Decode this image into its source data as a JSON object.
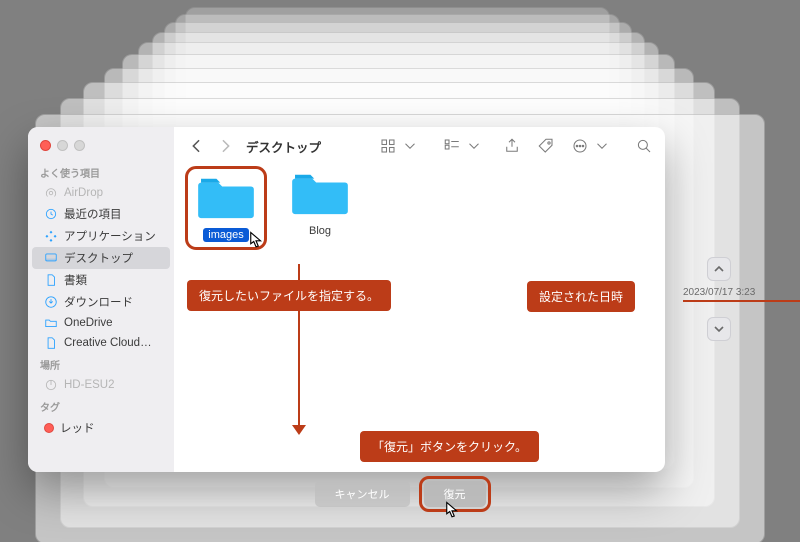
{
  "window": {
    "title": "デスクトップ"
  },
  "sidebar": {
    "sections": {
      "favorites": "よく使う項目",
      "locations": "場所",
      "tags": "タグ"
    },
    "items": [
      {
        "label": "AirDrop"
      },
      {
        "label": "最近の項目"
      },
      {
        "label": "アプリケーション"
      },
      {
        "label": "デスクトップ"
      },
      {
        "label": "書類"
      },
      {
        "label": "ダウンロード"
      },
      {
        "label": "OneDrive"
      },
      {
        "label": "Creative Cloud…"
      }
    ],
    "locations": [
      {
        "label": "HD-ESU2"
      }
    ],
    "tags": [
      {
        "label": "レッド"
      }
    ]
  },
  "content": {
    "folders": [
      {
        "label": "images",
        "selected": true
      },
      {
        "label": "Blog",
        "selected": false
      }
    ]
  },
  "timestamp": "2023/07/17 3:23",
  "annotations": {
    "select_file": "復元したいファイルを指定する。",
    "date_set": "設定された日時",
    "click_restore": "「復元」ボタンをクリック。"
  },
  "buttons": {
    "cancel": "キャンセル",
    "restore": "復元"
  }
}
